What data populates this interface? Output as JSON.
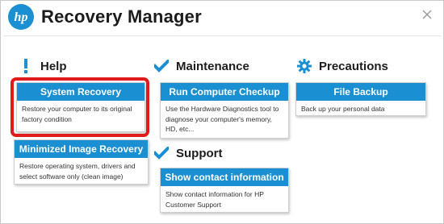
{
  "window": {
    "title": "Recovery Manager",
    "logo_text": "hp",
    "close_icon": "close-icon"
  },
  "sections": {
    "help": {
      "label": "Help",
      "icon": "exclamation-icon"
    },
    "maintenance": {
      "label": "Maintenance",
      "icon": "checkmark-icon"
    },
    "support": {
      "label": "Support",
      "icon": "checkmark-icon"
    },
    "precautions": {
      "label": "Precautions",
      "icon": "gear-icon"
    }
  },
  "tiles": {
    "system_recovery": {
      "title": "System Recovery",
      "description": "Restore your computer to its original factory condition"
    },
    "minimized_image_recovery": {
      "title": "Minimized Image Recovery",
      "description": "Restore operating system, drivers and select software only (clean image)"
    },
    "run_computer_checkup": {
      "title": "Run Computer Checkup",
      "description": "Use the Hardware Diagnostics tool to diagnose your computer's memory, HD, etc..."
    },
    "show_contact_information": {
      "title": "Show contact information",
      "description": "Show contact information for HP Customer Support"
    },
    "file_backup": {
      "title": "File Backup",
      "description": "Back up your personal data"
    }
  },
  "colors": {
    "accent": "#1a8fd1",
    "highlight": "#e01b1b",
    "text": "#1c1c1c"
  }
}
